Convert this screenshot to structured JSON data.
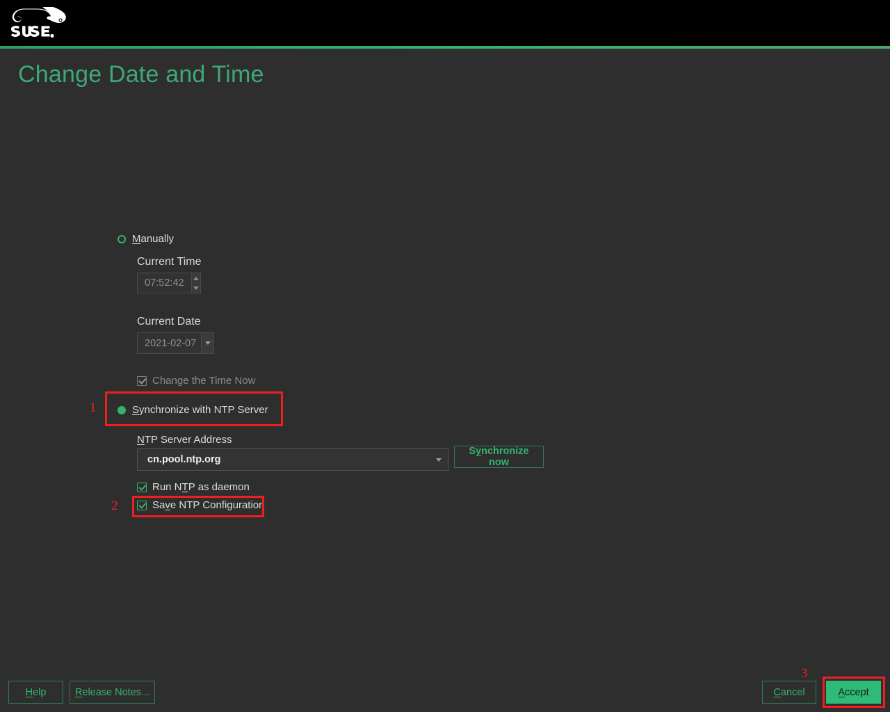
{
  "header": {
    "logo_name": "suse-logo",
    "logo_text": "SUSE."
  },
  "page": {
    "title": "Change Date and Time"
  },
  "colors": {
    "accent_green": "#35b36c",
    "title_green": "#3ea877",
    "primary_button_bg": "#30ba78",
    "annotation_red": "#f01f1f",
    "body_bg": "#2e2e2e",
    "header_bg": "#000000"
  },
  "form": {
    "manual_radio": {
      "label": "Manually",
      "mnemonic": "M",
      "selected": false
    },
    "current_time": {
      "label": "Current Time",
      "value": "07:52:42",
      "enabled": false
    },
    "current_date": {
      "label": "Current Date",
      "value": "2021-02-07",
      "enabled": false
    },
    "change_time_now": {
      "label": "Change the Time Now",
      "checked": true,
      "enabled": false
    },
    "ntp_radio": {
      "label": "Synchronize with NTP Server",
      "mnemonic": "S",
      "selected": true
    },
    "ntp_server": {
      "label": "NTP Server Address",
      "value": "cn.pool.ntp.org",
      "placeholder": "cn.pool.ntp.org"
    },
    "sync_now_button": {
      "label": "Synchronize now"
    },
    "run_ntp_daemon": {
      "label": "Run NTP as daemon",
      "checked": true
    },
    "save_ntp_config": {
      "label": "Save NTP Configuration",
      "checked": true
    }
  },
  "footer": {
    "help_label": "Help",
    "release_notes_label": "Release Notes...",
    "cancel_label": "Cancel",
    "accept_label": "Accept"
  },
  "annotations": [
    {
      "number": "1",
      "target": "ntp-radio"
    },
    {
      "number": "2",
      "target": "save-ntp-configuration-checkbox"
    },
    {
      "number": "3",
      "target": "accept-button"
    }
  ]
}
